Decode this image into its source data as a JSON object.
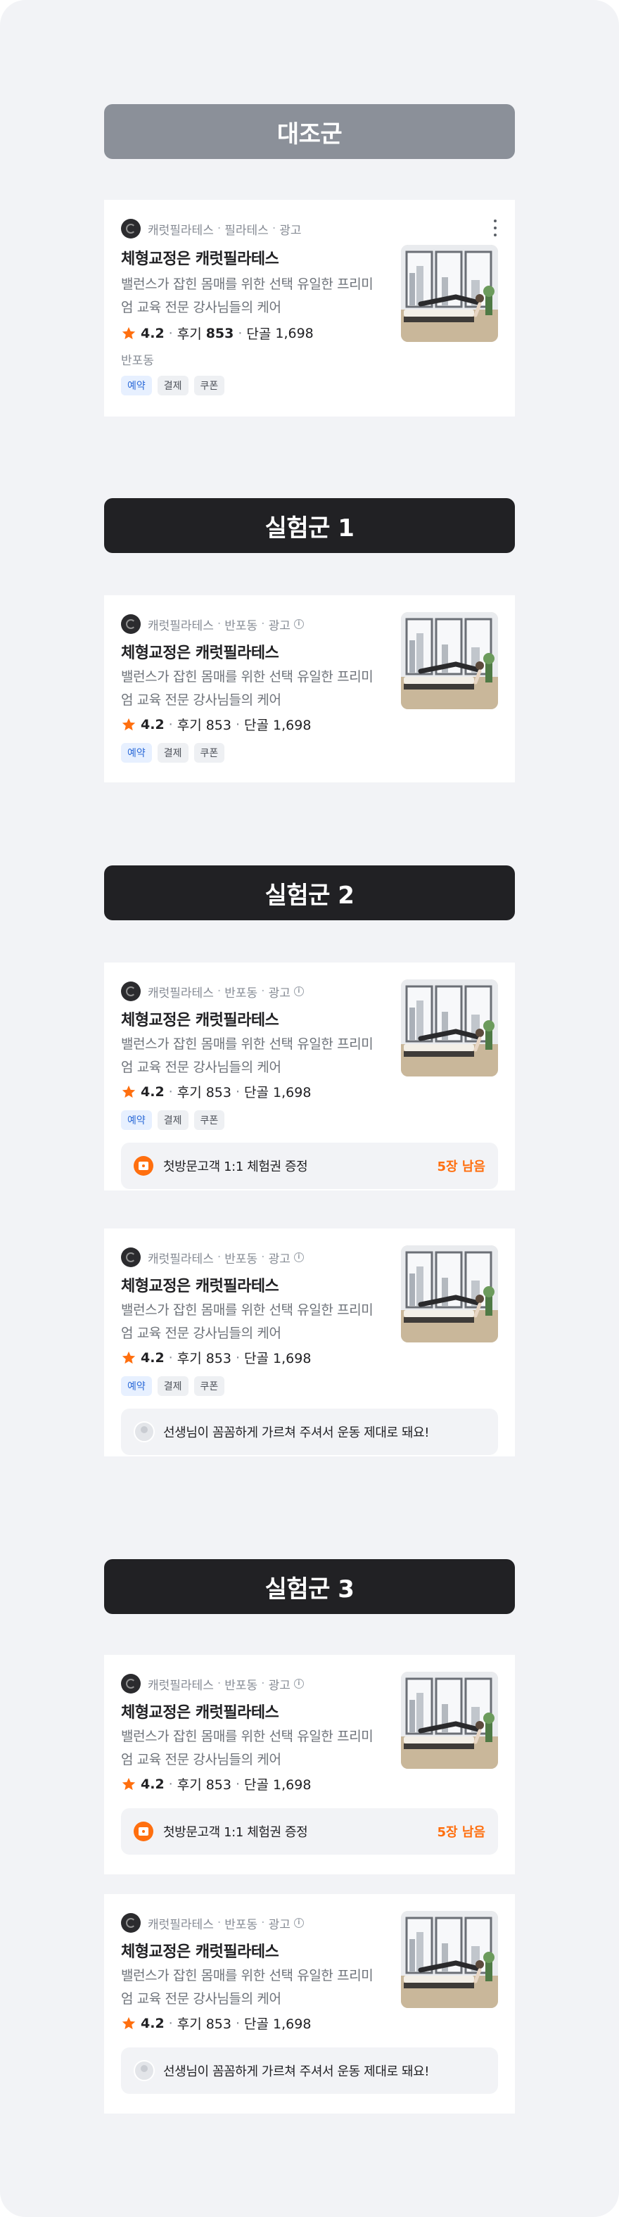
{
  "groups": [
    {
      "label": "대조군",
      "style": "gray"
    },
    {
      "label": "실험군 1",
      "style": "dark"
    },
    {
      "label": "실험군 2",
      "style": "dark"
    },
    {
      "label": "실험군 3",
      "style": "dark"
    }
  ],
  "control_card": {
    "brand": "캐럿필라테스",
    "meta_parts": [
      "필라테스",
      "광고"
    ],
    "title": "체형교정은 캐럿필라테스",
    "description": "밸런스가 잡힌 몸매를 위한 선택 유일한 프리미엄 교육 전문 강사님들의 케어",
    "rating": "4.2",
    "review_label": "후기",
    "review_count": "853",
    "regulars_label": "단골",
    "regulars_count": "1,698",
    "location": "반포동",
    "chips": [
      "예약",
      "결제",
      "쿠폰"
    ]
  },
  "variant_card": {
    "brand": "캐럿필라테스",
    "location": "반포동",
    "ad_label": "광고",
    "info_icon_glyph": "i",
    "title": "체형교정은 캐럿필라테스",
    "description": "밸런스가 잡힌 몸매를 위한 선택 유일한 프리미엄 교육 전문 강사님들의 케어",
    "rating": "4.2",
    "review_text": "후기 853",
    "regulars_text": "단골 1,698",
    "chips": [
      "예약",
      "결제",
      "쿠폰"
    ]
  },
  "coupon": {
    "text": "첫방문고객 1:1 체험권 증정",
    "remaining": "5장 남음"
  },
  "review_snippet": {
    "text": "선생님이 꼼꼼하게 가르쳐 주셔서 운동 제대로 돼요!"
  },
  "colors": {
    "page_bg": "#f2f3f6",
    "control_header": "#8b9099",
    "variant_header": "#212124",
    "accent_orange": "#ff6f0f",
    "chip_blue": "#2d6bd8"
  },
  "icons": {
    "star": "star-icon",
    "more": "more-vertical-icon",
    "info": "info-icon",
    "coupon": "coupon-icon",
    "avatar": "avatar-icon"
  }
}
